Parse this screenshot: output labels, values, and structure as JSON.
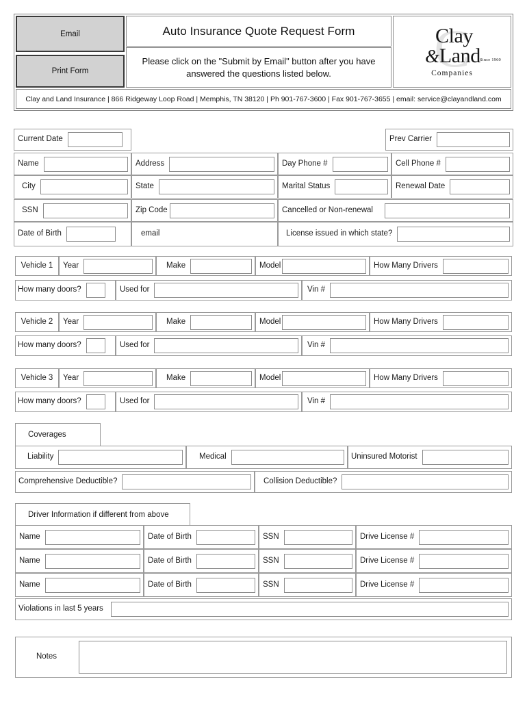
{
  "header": {
    "email_button": "Email",
    "print_button": "Print Form",
    "title": "Auto Insurance Quote Request Form",
    "subtitle": "Please click on the \"Submit by Email\" button after you have answered the questions listed below.",
    "logo": {
      "line1": "Clay",
      "amp": "&",
      "line2": "Land",
      "since": "Since 1960",
      "line3": "Companies",
      "ghost": "C"
    },
    "address_line": "Clay and Land Insurance | 866 Ridgeway Loop Road | Memphis, TN 38120 | Ph 901-767-3600 | Fax 901-767-3655 | email: service@clayandland.com"
  },
  "personal": {
    "current_date": "Current Date",
    "prev_carrier": "Prev Carrier",
    "name": "Name",
    "address": "Address",
    "day_phone": "Day Phone #",
    "cell_phone": "Cell Phone #",
    "city": "City",
    "state": "State",
    "marital_status": "Marital Status",
    "renewal_date": "Renewal Date",
    "ssn": "SSN",
    "zip_code": "Zip Code",
    "cancelled": "Cancelled or Non-renewal",
    "date_of_birth": "Date of Birth",
    "email": "email",
    "license_state": "License issued in which state?"
  },
  "vehicle_labels": {
    "year": "Year",
    "make": "Make",
    "model": "Model",
    "how_many_drivers": "How Many Drivers",
    "how_many_doors": "How many doors?",
    "used_for": "Used for",
    "vin": "Vin #"
  },
  "vehicles": [
    {
      "title": "Vehicle 1"
    },
    {
      "title": "Vehicle 2"
    },
    {
      "title": "Vehicle 3"
    }
  ],
  "coverages": {
    "tab": "Coverages",
    "liability": "Liability",
    "medical": "Medical",
    "uninsured_motorist": "Uninsured Motorist",
    "comprehensive_deductible": "Comprehensive Deductible?",
    "collision_deductible": "Collision Deductible?"
  },
  "driver_info": {
    "tab": "Driver Information if different from above",
    "name": "Name",
    "date_of_birth": "Date of Birth",
    "ssn": "SSN",
    "drive_license": "Drive License #",
    "rows": [
      {
        "id": "driver-row-1"
      },
      {
        "id": "driver-row-2"
      },
      {
        "id": "driver-row-3"
      }
    ],
    "violations": "Violations in last 5 years"
  },
  "notes": {
    "label": "Notes"
  }
}
